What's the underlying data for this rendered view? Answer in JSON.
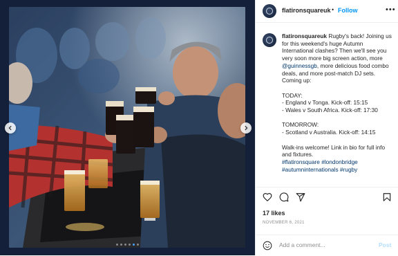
{
  "post": {
    "username": "flatironsquareuk",
    "follow_label": "Follow",
    "more_label": "•••",
    "header_dot": "•",
    "caption_lines": [
      {
        "type": "first",
        "text": "Rugby's back! Joining us for this weekend's huge Autumn International clashes? Then we'll see you very soon more big screen action, more "
      },
      {
        "type": "mention",
        "text": "@guinnessgb"
      },
      {
        "type": "after_mention",
        "text": ", more delicious food combo deals, and more post-match DJ sets. Coming up:"
      }
    ],
    "today_heading": "TODAY:",
    "today_items": [
      "- England v Tonga. Kick-off: 15:15",
      "- Wales v South Africa. Kick-off: 17:30"
    ],
    "tomorrow_heading": "TOMORROW:",
    "tomorrow_items": [
      "- Scotland v Australia. Kick-off: 14:15"
    ],
    "walkins": "Walk-ins welcome! Link in bio for full info and fixtures.",
    "hashtags": [
      "#flatironsquare",
      "#londonbridge",
      "#autumninternationals",
      "#rugby"
    ],
    "likes": "17 likes",
    "date": "NOVEMBER 6, 2021",
    "comment_placeholder": "Add a comment...",
    "post_label": "Post"
  },
  "carousel": {
    "total_slides": 6,
    "active_slide": 5
  },
  "icons": {
    "like": "heart-icon",
    "comment": "comment-icon",
    "share": "share-icon",
    "save": "bookmark-icon",
    "emoji": "smiley-icon",
    "prev": "chevron-left-icon",
    "next": "chevron-right-icon"
  },
  "colors": {
    "link": "#00376b",
    "follow": "#0095f6",
    "active_dot": "#4aa3ff"
  }
}
